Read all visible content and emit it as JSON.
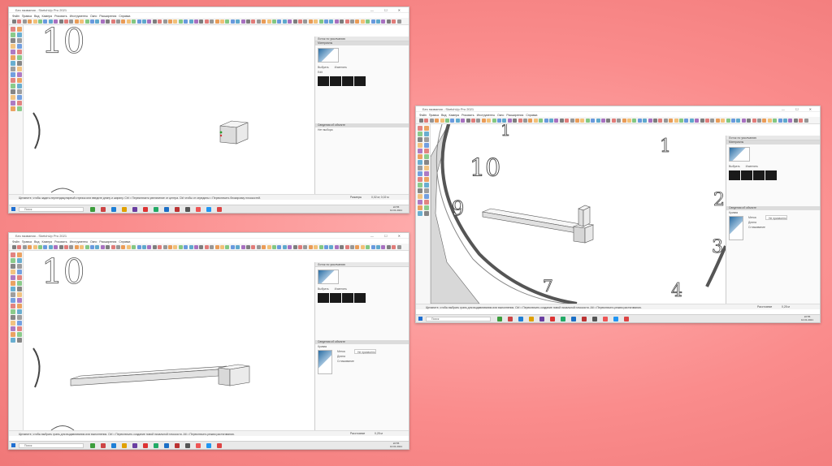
{
  "window": {
    "title": "Без названия - SketchUp Pro 2021",
    "controls": "— ☐ ✕"
  },
  "menu": [
    "Файл",
    "Правка",
    "Вид",
    "Камера",
    "Рисовать",
    "Инструменты",
    "Окно",
    "Расширения",
    "Справка"
  ],
  "panel": {
    "title": "Лоток по умолчанию",
    "materials_section": "Материалы",
    "entity_section": "Сведения об объекте",
    "select_label": "Выбрать",
    "edit_label": "Изменить",
    "edit_value": "Edit",
    "no_selection": "Нет выбора",
    "edges_label": "Кривая",
    "layer_label": "Метка",
    "layer_value": "Не присвоено",
    "length_label": "Длина",
    "soften_label": "Сглаживание"
  },
  "taskbar": {
    "search_placeholder": "Поиск",
    "clock_time": "22:55",
    "clock_date": "10.01.2021"
  },
  "screens": [
    {
      "status": "Щелкните, чтобы задать перпендикулярный отрезок или введите длину и ширину. Ctrl = Переключить увеличение от центра. Ctrl чтобы от середины = Переключить блокировку плоскостей.",
      "measure_label": "Размеры",
      "measure_value": "0,02 м; 0,02 м"
    },
    {
      "status": "Щелкните, чтобы выбрать грань для выдавливания или выполнения. Ctrl = Переключить создание новой начальной плоскости. Alt = Переключить режим растягивания.",
      "measure_label": "Расстояние",
      "measure_value": "0,25 м"
    },
    {
      "status": "Щелкните, чтобы выбрать грань для выдавливания или выполнения. Ctrl = Переключить создание новой начальной плоскости. Alt = Переключить режим растягивания.",
      "measure_label": "Расстояние",
      "measure_value": "0,25 м"
    }
  ],
  "clock_numerals": [
    "10",
    "9",
    "7",
    "1",
    "2",
    "3",
    "4",
    "10"
  ],
  "colors": {
    "background": "#fa8c8c",
    "panel_swatch": "#1a1a1a",
    "selection_blue": "#2b6da3"
  }
}
